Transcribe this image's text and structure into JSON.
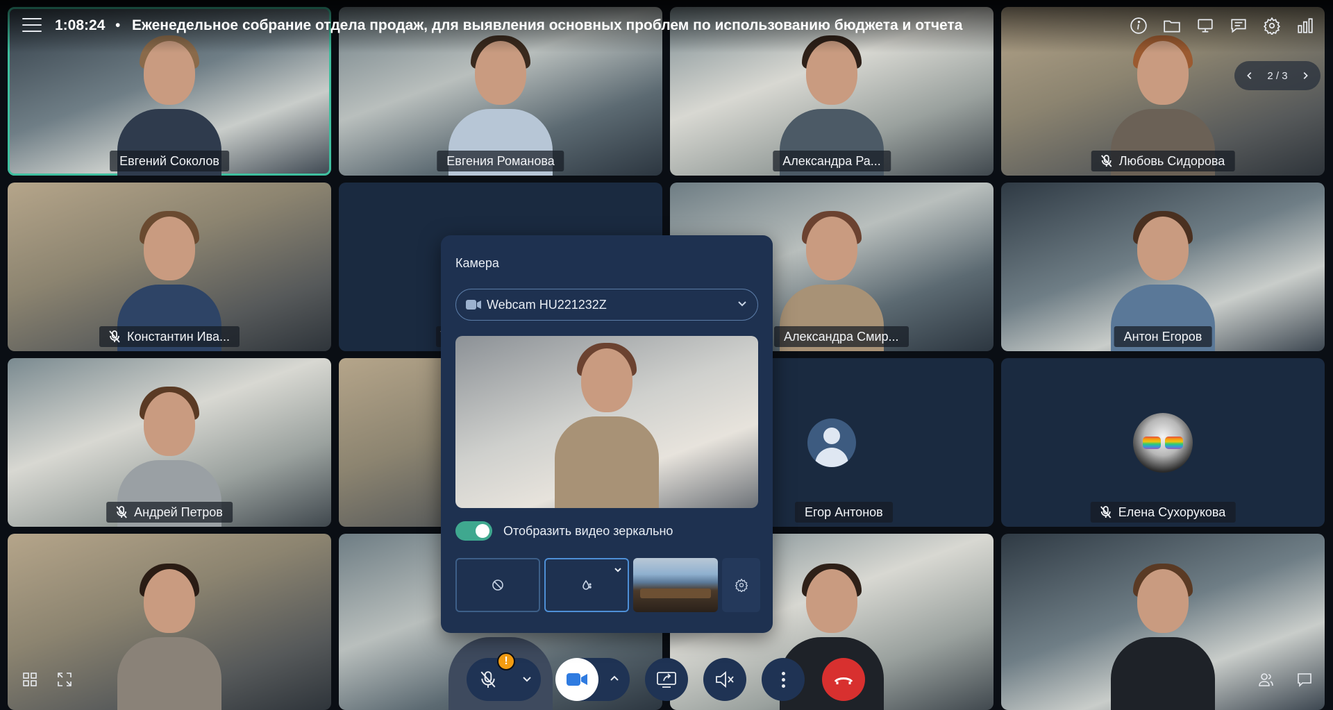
{
  "header": {
    "time": "1:08:24",
    "separator": "•",
    "title": "Еженедельное собрание отдела продаж, для выявления основных проблем по использованию бюджета и отчета"
  },
  "pager": {
    "text": "2 / 3"
  },
  "tiles": [
    {
      "name": "Евгений Соколов",
      "muted": false,
      "active": true
    },
    {
      "name": "Евгения Романова",
      "muted": false
    },
    {
      "name": "Александра Ра...",
      "muted": false
    },
    {
      "name": "Любовь Сидорова",
      "muted": true
    },
    {
      "name": "Константин Ива...",
      "muted": true
    },
    {
      "name": "",
      "muted": true
    },
    {
      "name": "Александра Смир...",
      "muted": false
    },
    {
      "name": "Антон Егоров",
      "muted": false
    },
    {
      "name": "Андрей Петров",
      "muted": true
    },
    {
      "name": "",
      "muted": false
    },
    {
      "name": "Егор Антонов",
      "muted": false
    },
    {
      "name": "Елена Сухорукова",
      "muted": true
    }
  ],
  "camera_popup": {
    "title": "Камера",
    "device": "Webcam HU221232Z",
    "mirror_label": "Отобразить видео зеркально",
    "mirror_enabled": true
  },
  "controls": {
    "mic_warning": "!",
    "hangup_color": "#d8302f",
    "accent": "#3fa88f",
    "camera_accent": "#2f7be0"
  },
  "icons": {
    "top": [
      "info-icon",
      "folder-icon",
      "screen-icon",
      "chat-list-icon",
      "gear-icon",
      "stats-icon"
    ],
    "bottom_left": [
      "grid-icon",
      "fullscreen-icon"
    ],
    "bottom_right": [
      "participants-icon",
      "chat-icon"
    ]
  }
}
